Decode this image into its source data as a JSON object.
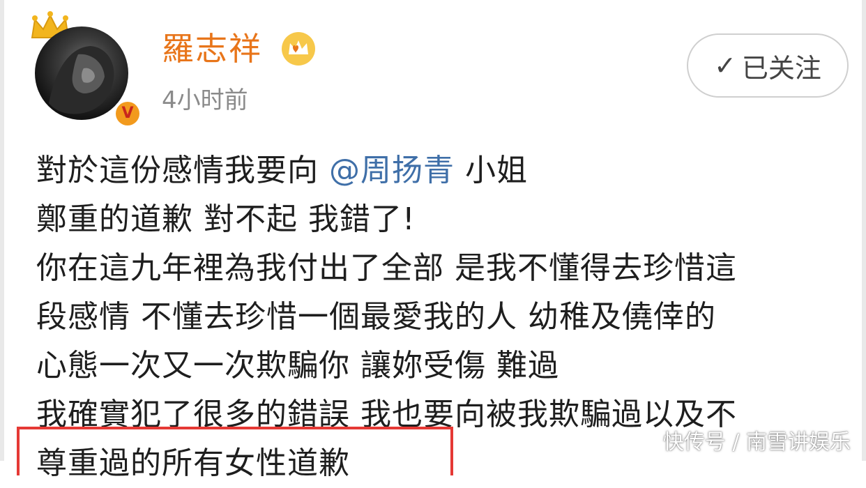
{
  "user": {
    "name": "羅志祥",
    "timestamp": "4小时前",
    "verified_badge": "V"
  },
  "follow_button": {
    "label": "已关注",
    "icon": "check-icon"
  },
  "post": {
    "lines": [
      {
        "before": "對於這份感情我要向 ",
        "mention": "@周扬青",
        "after": " 小姐"
      },
      {
        "before": "鄭重的道歉 對不起 我錯了!",
        "mention": "",
        "after": ""
      },
      {
        "before": "你在這九年裡為我付出了全部 是我不懂得去珍惜這",
        "mention": "",
        "after": ""
      },
      {
        "before": "段感情 不懂去珍惜一個最愛我的人 幼稚及僥倖的",
        "mention": "",
        "after": ""
      },
      {
        "before": "心態一次又一次欺騙你 讓妳受傷 難過",
        "mention": "",
        "after": ""
      },
      {
        "before": "我確實犯了很多的錯誤 我也要向被我欺騙過以及不",
        "mention": "",
        "after": ""
      },
      {
        "before": "尊重過的所有女性道歉",
        "mention": "",
        "after": ""
      }
    ]
  },
  "watermark": "快传号 / 南雪讲娱乐",
  "colors": {
    "username": "#e8751a",
    "mention": "#3f6fa8",
    "highlight": "#e53935"
  }
}
